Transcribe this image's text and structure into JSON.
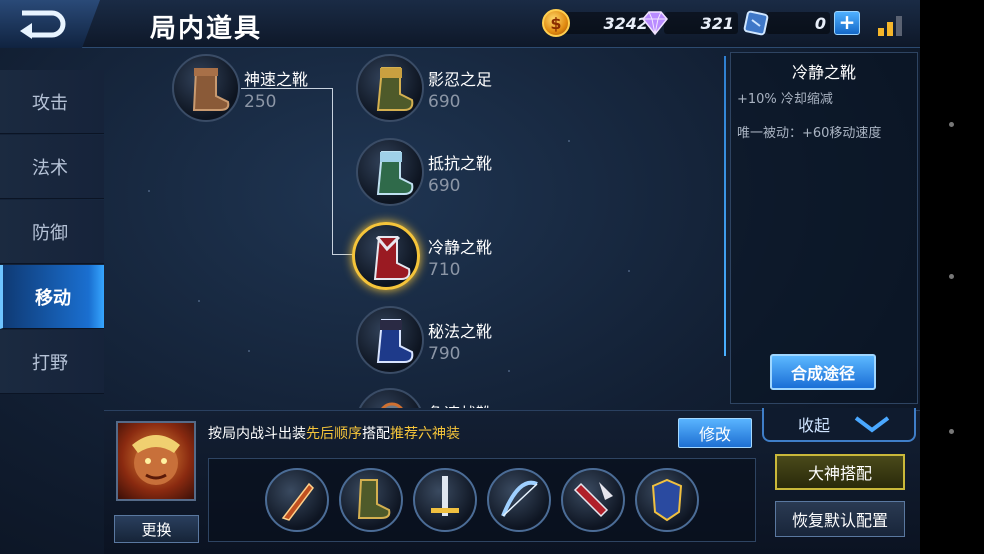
{
  "header": {
    "title": "局内道具",
    "back_icon": "back-arrow-icon",
    "gold": "3242",
    "diamonds": "321",
    "vouchers": "0",
    "gold_icon": "gold-coin-icon",
    "diamond_icon": "diamond-icon",
    "voucher_icon": "voucher-icon",
    "add_icon": "plus-icon",
    "signal_icon": "signal-bars-icon"
  },
  "sidebar": {
    "items": [
      {
        "label": "攻击",
        "active": false
      },
      {
        "label": "法术",
        "active": false
      },
      {
        "label": "防御",
        "active": false
      },
      {
        "label": "移动",
        "active": true
      },
      {
        "label": "打野",
        "active": false
      }
    ]
  },
  "tree": {
    "base": {
      "name": "神速之靴",
      "price": "250"
    },
    "upgrades": [
      {
        "name": "影忍之足",
        "price": "690"
      },
      {
        "name": "抵抗之靴",
        "price": "690"
      },
      {
        "name": "冷静之靴",
        "price": "710",
        "selected": true
      },
      {
        "name": "秘法之靴",
        "price": "790"
      },
      {
        "name": "急速战靴",
        "price": ""
      }
    ]
  },
  "detail": {
    "title": "冷静之靴",
    "stat": "+10% 冷却缩减",
    "passive": "唯一被动：+60移动速度",
    "craft_button": "合成途径"
  },
  "loadout": {
    "hint_prefix": "按局内战斗出装",
    "hint_order": "先后顺序",
    "hint_mid": "搭配",
    "hint_six": "推荐六神装",
    "modify_button": "修改",
    "change_button": "更换",
    "collapse_label": "收起",
    "expert_button": "大神搭配",
    "reset_button": "恢复默认配置",
    "slot_icons": [
      "blade-item-icon",
      "boots-item-icon",
      "sword-item-icon",
      "bow-item-icon",
      "axe-item-icon",
      "armor-item-icon"
    ]
  },
  "colors": {
    "accent_blue": "#1a6fd0",
    "gold_highlight": "#f5c43a",
    "price_gray": "#8c96a6"
  }
}
